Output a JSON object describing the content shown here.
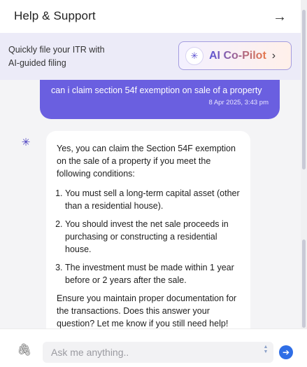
{
  "header": {
    "title": "Help & Support",
    "close_icon": "→"
  },
  "banner": {
    "line1": "Quickly file your ITR with",
    "line2": "AI-guided filing",
    "copilot": {
      "icon": "✳",
      "label": "AI Co-Pilot",
      "chevron": "›"
    }
  },
  "chat": {
    "user_message": {
      "text": "can i claim section 54f exemption on sale of a property",
      "time": "8 Apr 2025, 3:43 pm"
    },
    "bot_avatar_icon": "✳",
    "bot_message": {
      "intro": "Yes, you can claim the Section 54F exemption on the sale of a property if you meet the following conditions:",
      "items": [
        "You must sell a long-term capital asset (other than a residential house).",
        "You should invest the net sale proceeds in purchasing or constructing a residential house.",
        "The investment must be made within 1 year before or 2 years after the sale."
      ],
      "outro": "Ensure you maintain proper documentation for the transactions. Does this answer your question? Let me know if you still need help!"
    }
  },
  "footer": {
    "attach_icon": "🖇",
    "input_placeholder": "Ask me anything..",
    "input_value": "",
    "send_icon": "➔"
  },
  "colors": {
    "accent": "#6a5fe0",
    "send": "#2f6ee6",
    "banner_bg": "#ecebf8"
  }
}
